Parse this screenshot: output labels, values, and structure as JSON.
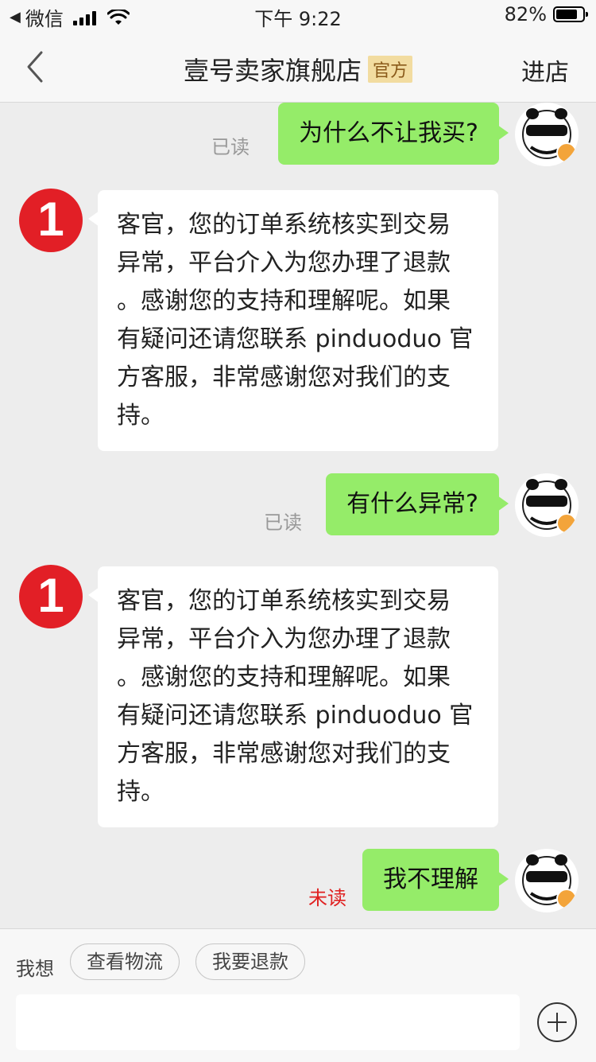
{
  "status_bar": {
    "back_app": "微信",
    "time": "下午 9:22",
    "battery": "82%",
    "battery_level": 0.82
  },
  "header": {
    "title": "壹号卖家旗舰店",
    "badge": "官方",
    "enter_store": "进店"
  },
  "colors": {
    "outgoing_bubble": "#95ec69",
    "store_avatar": "#e21f26",
    "unread_text": "#e02020"
  },
  "messages": [
    {
      "sender": "user",
      "text": "为什么不让我买?",
      "status": "已读"
    },
    {
      "sender": "store",
      "avatar_text": "1",
      "lines": [
        "客官，您的订单系统核实到交易",
        "异常，平台介入为您办理了退款",
        "。感谢您的支持和理解呢。如果",
        "有疑问还请您联系 pinduoduo 官",
        "方客服，非常感谢您对我们的支",
        "持。"
      ]
    },
    {
      "sender": "user",
      "text": "有什么异常?",
      "status": "已读"
    },
    {
      "sender": "store",
      "avatar_text": "1",
      "lines": [
        "客官，您的订单系统核实到交易",
        "异常，平台介入为您办理了退款",
        "。感谢您的支持和理解呢。如果",
        "有疑问还请您联系 pinduoduo 官",
        "方客服，非常感谢您对我们的支",
        "持。"
      ]
    },
    {
      "sender": "user",
      "text": "我不理解",
      "status": "未读"
    }
  ],
  "quick_replies": {
    "label": "我想",
    "items": [
      "查看物流",
      "我要退款"
    ]
  }
}
